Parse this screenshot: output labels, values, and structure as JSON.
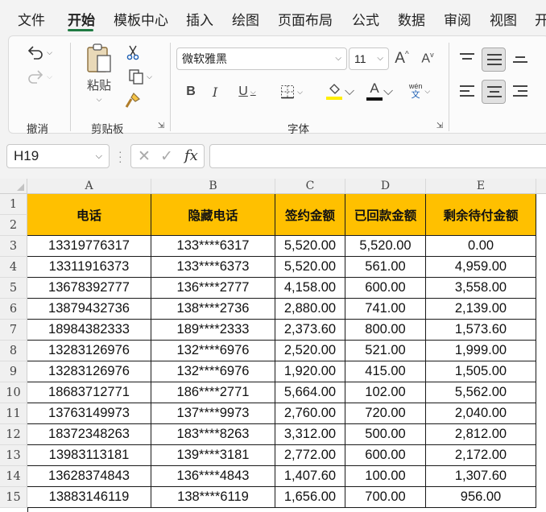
{
  "menu": {
    "tabs": [
      "文件",
      "开始",
      "模板中心",
      "插入",
      "绘图",
      "页面布局",
      "公式",
      "数据",
      "审阅",
      "视图",
      "开"
    ]
  },
  "ribbon": {
    "groups": {
      "undo": "撤消",
      "clipboard": "剪贴板",
      "font": "字体"
    },
    "paste_label": "粘贴",
    "font_name": "微软雅黑",
    "font_size": "11",
    "wen_label": "wén",
    "wen_char": "文",
    "accent_colors": {
      "highlight": "#ffee00",
      "font_color": "#111111"
    }
  },
  "formula_bar": {
    "name_box": "H19",
    "fx_label": "fx",
    "formula": ""
  },
  "sheet": {
    "columns": [
      "A",
      "B",
      "C",
      "D",
      "E"
    ],
    "row_numbers": [
      "1",
      "2",
      "3",
      "4",
      "5",
      "6",
      "7",
      "8",
      "9",
      "10",
      "11",
      "12",
      "13",
      "14",
      "15"
    ],
    "header_fill": "#ffc000",
    "headers": [
      "电话",
      "隐藏电话",
      "签约金额",
      "已回款金额",
      "剩余待付金额"
    ],
    "rows": [
      [
        "13319776317",
        "133****6317",
        "5,520.00",
        "5,520.00",
        "0.00"
      ],
      [
        "13311916373",
        "133****6373",
        "5,520.00",
        "561.00",
        "4,959.00"
      ],
      [
        "13678392777",
        "136****2777",
        "4,158.00",
        "600.00",
        "3,558.00"
      ],
      [
        "13879432736",
        "138****2736",
        "2,880.00",
        "741.00",
        "2,139.00"
      ],
      [
        "18984382333",
        "189****2333",
        "2,373.60",
        "800.00",
        "1,573.60"
      ],
      [
        "13283126976",
        "132****6976",
        "2,520.00",
        "521.00",
        "1,999.00"
      ],
      [
        "13283126976",
        "132****6976",
        "1,920.00",
        "415.00",
        "1,505.00"
      ],
      [
        "18683712771",
        "186****2771",
        "5,664.00",
        "102.00",
        "5,562.00"
      ],
      [
        "13763149973",
        "137****9973",
        "2,760.00",
        "720.00",
        "2,040.00"
      ],
      [
        "18372348263",
        "183****8263",
        "3,312.00",
        "500.00",
        "2,812.00"
      ],
      [
        "13983113181",
        "139****3181",
        "2,772.00",
        "600.00",
        "2,172.00"
      ],
      [
        "13628374843",
        "136****4843",
        "1,407.60",
        "100.00",
        "1,307.60"
      ],
      [
        "13883146119",
        "138****6119",
        "1,656.00",
        "700.00",
        "956.00"
      ]
    ]
  }
}
